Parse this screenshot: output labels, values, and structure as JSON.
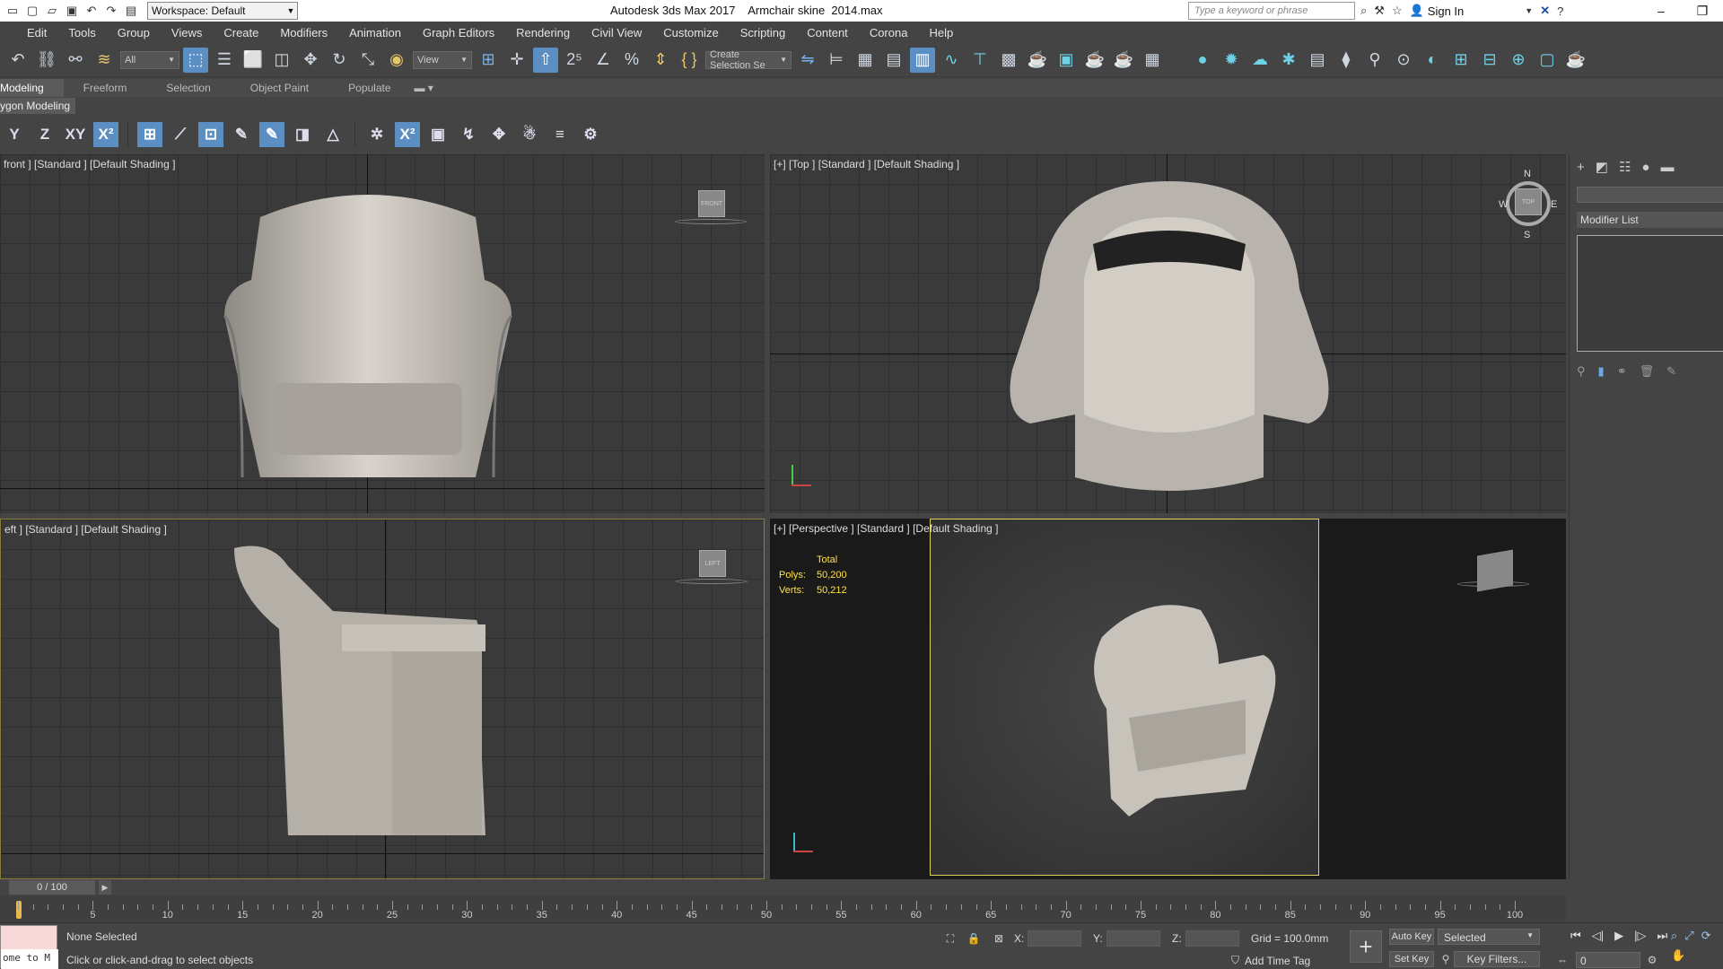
{
  "titlebar": {
    "workspace": "Workspace: Default",
    "app_title": "Autodesk 3ds Max 2017",
    "file_name": "Armchair skine  2014.max",
    "search_placeholder": "Type a keyword or phrase",
    "sign_in": "Sign In"
  },
  "menu": [
    "Edit",
    "Tools",
    "Group",
    "Views",
    "Create",
    "Modifiers",
    "Animation",
    "Graph Editors",
    "Rendering",
    "Civil View",
    "Customize",
    "Scripting",
    "Content",
    "Corona",
    "Help"
  ],
  "toolbar": {
    "filter_value": "All",
    "ref_coord": "View",
    "selection_set": "Create Selection Se"
  },
  "ribbon": {
    "tabs": [
      "Modeling",
      "Freeform",
      "Selection",
      "Object Paint",
      "Populate"
    ],
    "sub_label": "ygon Modeling",
    "axis_buttons": [
      "Y",
      "Z",
      "XY"
    ]
  },
  "viewports": {
    "front": "front ] [Standard ] [Default Shading ]",
    "top": "[+] [Top ] [Standard ] [Default Shading ]",
    "left": "eft ] [Standard ] [Default Shading ]",
    "perspective": "[+] [Perspective ] [Standard ] [Default Shading ]",
    "cube_front": "FRONT",
    "cube_top": "TOP",
    "cube_left": "LEFT",
    "compass": {
      "n": "N",
      "s": "S",
      "e": "E",
      "w": "W"
    }
  },
  "stats": {
    "header": "Total",
    "polys_label": "Polys:",
    "polys_value": "50,200",
    "verts_label": "Verts:",
    "verts_value": "50,212"
  },
  "command_panel": {
    "modifier_list": "Modifier List"
  },
  "timeline": {
    "slider": "0 / 100",
    "ticks": [
      "5",
      "10",
      "15",
      "20",
      "25",
      "30",
      "35",
      "40",
      "45",
      "50",
      "55",
      "60",
      "65",
      "70",
      "75",
      "80",
      "85",
      "90",
      "95",
      "100"
    ]
  },
  "status": {
    "maxscript": "ome to M",
    "selection": "None Selected",
    "prompt": "Click or click-and-drag to select objects",
    "x_label": "X:",
    "y_label": "Y:",
    "z_label": "Z:",
    "grid": "Grid = 100.0mm",
    "add_time_tag": "Add Time Tag",
    "auto_key": "Auto Key",
    "set_key": "Set Key",
    "selected_dd": "Selected",
    "key_filters": "Key Filters...",
    "frame": "0"
  },
  "colors": {
    "accent": "#5b8ec2",
    "active_viewport_border": "#e2d15b",
    "stats_text": "#ffe14a",
    "playhead": "#e6b94a"
  }
}
